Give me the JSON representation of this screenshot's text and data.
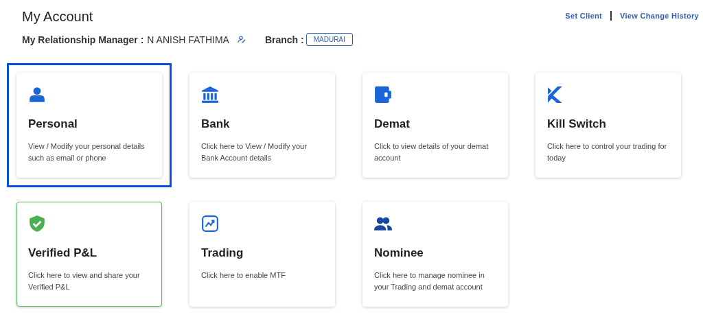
{
  "title": "My Account",
  "links": [
    "Set Client",
    "View Change History"
  ],
  "manager": {
    "label": "My Relationship Manager :",
    "name": "N ANISH FATHIMA"
  },
  "branch": {
    "label": "Branch :",
    "value": "MADURAI"
  },
  "cards": [
    {
      "kind": "person",
      "title": "Personal",
      "description": "View / Modify your personal details such as email or phone",
      "selected": true,
      "verified": false
    },
    {
      "kind": "bank",
      "title": "Bank",
      "description": "Click here to View / Modify your Bank Account details",
      "selected": false,
      "verified": false
    },
    {
      "kind": "wallet",
      "title": "Demat",
      "description": "Click to view details of your demat account",
      "selected": false,
      "verified": false
    },
    {
      "kind": "switch",
      "title": "Kill Switch",
      "description": "Click here to control your trading for today",
      "selected": false,
      "verified": false
    },
    {
      "kind": "shield",
      "title": "Verified P&L",
      "description": "Click here to view and share your Verified P&L",
      "selected": false,
      "verified": true
    },
    {
      "kind": "trend",
      "title": "Trading",
      "description": "Click here to enable MTF",
      "selected": false,
      "verified": false
    },
    {
      "kind": "people",
      "title": "Nominee",
      "description": "Click here to manage nominee in your Trading and demat account",
      "selected": false,
      "verified": false
    }
  ]
}
